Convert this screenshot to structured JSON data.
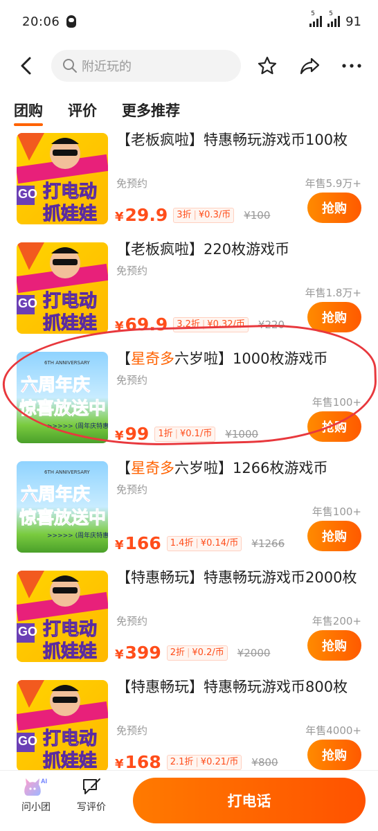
{
  "status": {
    "time": "20:06",
    "battery": "91"
  },
  "search": {
    "placeholder": "附近玩的"
  },
  "tabs": [
    {
      "label": "团购"
    },
    {
      "label": "评价"
    },
    {
      "label": "更多推荐"
    }
  ],
  "products": [
    {
      "title": "【老板疯啦】特惠畅玩游戏币100枚",
      "subtitle": "免预约",
      "sold": "年售5.9万+",
      "price": "29.9",
      "discount": "3折",
      "unit_price": "¥0.3/币",
      "original": "¥100",
      "buy_label": "抢购",
      "thumb_text_1": "打电动",
      "thumb_text_2": "抓娃娃"
    },
    {
      "title": "【老板疯啦】220枚游戏币",
      "subtitle": "免预约",
      "sold": "年售1.8万+",
      "price": "69.9",
      "discount": "3.2折",
      "unit_price": "¥0.32/币",
      "original": "¥220",
      "buy_label": "抢购",
      "thumb_text_1": "打电动",
      "thumb_text_2": "抓娃娃"
    },
    {
      "title_prefix": "【",
      "title_hl": "星奇多",
      "title_rest": "六岁啦】1000枚游戏币",
      "subtitle": "免预约",
      "sold": "年售100+",
      "price": "99",
      "discount": "1折",
      "unit_price": "¥0.1/币",
      "original": "¥1000",
      "buy_label": "抢购",
      "thumb_small": "6TH ANNIVERSARY",
      "thumb_text_1": "六周年庆",
      "thumb_text_2": "惊喜放送中",
      "thumb_text_3": ">>>>> (周年庆特惠"
    },
    {
      "title_prefix": "【",
      "title_hl": "星奇多",
      "title_rest": "六岁啦】1266枚游戏币",
      "subtitle": "免预约",
      "sold": "年售100+",
      "price": "166",
      "discount": "1.4折",
      "unit_price": "¥0.14/币",
      "original": "¥1266",
      "buy_label": "抢购",
      "thumb_small": "6TH ANNIVERSARY",
      "thumb_text_1": "六周年庆",
      "thumb_text_2": "惊喜放送中",
      "thumb_text_3": ">>>>> (周年庆特惠"
    },
    {
      "title": "【特惠畅玩】特惠畅玩游戏币2000枚",
      "subtitle": "免预约",
      "sold": "年售200+",
      "price": "399",
      "discount": "2折",
      "unit_price": "¥0.2/币",
      "original": "¥2000",
      "buy_label": "抢购",
      "thumb_text_1": "打电动",
      "thumb_text_2": "抓娃娃"
    },
    {
      "title": "【特惠畅玩】特惠畅玩游戏币800枚",
      "subtitle": "免预约",
      "sold": "年售4000+",
      "price": "168",
      "discount": "2.1折",
      "unit_price": "¥0.21/币",
      "original": "¥800",
      "buy_label": "抢购",
      "thumb_text_1": "打电动",
      "thumb_text_2": "抓娃娃"
    }
  ],
  "bottom": {
    "assistant_label": "问小团",
    "review_label": "写评价",
    "call_label": "打电话"
  },
  "colors": {
    "accent": "#ff6200",
    "price": "#ff4d1a"
  }
}
